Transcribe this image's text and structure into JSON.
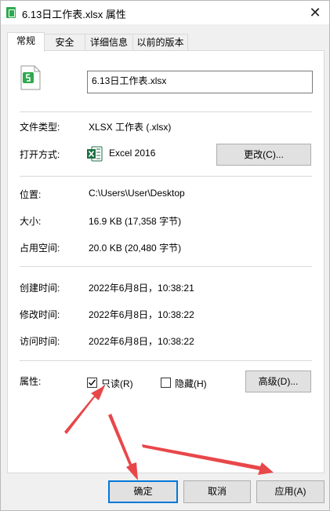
{
  "window": {
    "title": "6.13日工作表.xlsx 属性",
    "close_glyph": "✕"
  },
  "tabs": [
    {
      "label": "常规",
      "active": true
    },
    {
      "label": "安全",
      "active": false
    },
    {
      "label": "详细信息",
      "active": false
    },
    {
      "label": "以前的版本",
      "active": false
    }
  ],
  "general": {
    "filename": "6.13日工作表.xlsx",
    "file_type_label": "文件类型:",
    "file_type_value": "XLSX 工作表 (.xlsx)",
    "open_with_label": "打开方式:",
    "open_with_value": "Excel 2016",
    "change_button": "更改(C)...",
    "location_label": "位置:",
    "location_value": "C:\\Users\\User\\Desktop",
    "size_label": "大小:",
    "size_value": "16.9 KB (17,358 字节)",
    "size_on_disk_label": "占用空间:",
    "size_on_disk_value": "20.0 KB (20,480 字节)",
    "created_label": "创建时间:",
    "created_value": "2022年6月8日，10:38:21",
    "modified_label": "修改时间:",
    "modified_value": "2022年6月8日，10:38:22",
    "accessed_label": "访问时间:",
    "accessed_value": "2022年6月8日，10:38:22",
    "attributes_label": "属性:",
    "readonly_label": "只读(R)",
    "readonly_checked": true,
    "hidden_label": "隐藏(H)",
    "hidden_checked": false,
    "advanced_button": "高级(D)..."
  },
  "footer": {
    "ok_button": "确定",
    "cancel_button": "取消",
    "apply_button": "应用(A)"
  },
  "colors": {
    "accent": "#0078d7",
    "annotation_arrow": "#e8474a",
    "excel_green": "#1d7044"
  },
  "icons": {
    "title": "spreadsheet-file-icon",
    "file": "spreadsheet-file-icon",
    "app": "excel-icon",
    "close": "close-icon"
  }
}
